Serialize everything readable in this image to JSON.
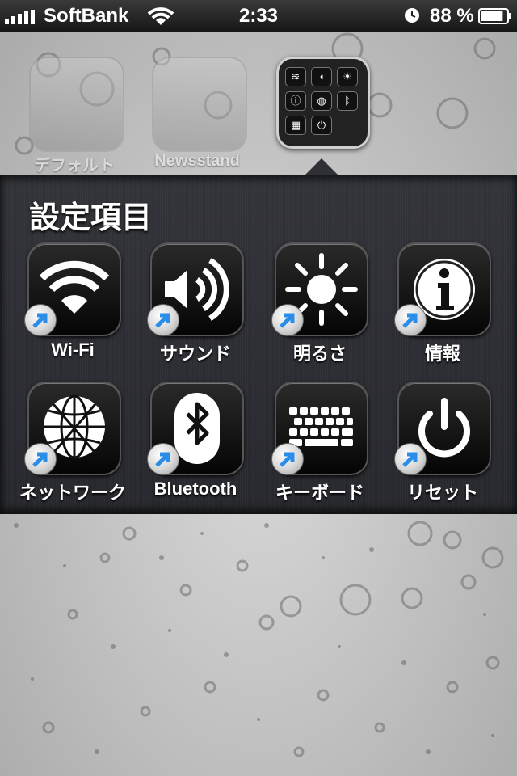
{
  "status_bar": {
    "carrier": "SoftBank",
    "time": "2:33",
    "battery_percent": "88 %",
    "battery_level": 0.88
  },
  "home_row": {
    "folder1_label": "デフォルト",
    "folder2_label": "Newsstand"
  },
  "folder": {
    "title": "設定項目",
    "apps": [
      {
        "label": "Wi-Fi",
        "icon": "wifi-icon"
      },
      {
        "label": "サウンド",
        "icon": "sound-icon"
      },
      {
        "label": "明るさ",
        "icon": "brightness-icon"
      },
      {
        "label": "情報",
        "icon": "info-icon"
      },
      {
        "label": "ネットワーク",
        "icon": "network-globe-icon"
      },
      {
        "label": "Bluetooth",
        "icon": "bluetooth-icon"
      },
      {
        "label": "キーボード",
        "icon": "keyboard-icon"
      },
      {
        "label": "リセット",
        "icon": "power-icon"
      }
    ]
  },
  "colors": {
    "panel": "#2c2d32",
    "shortcut_arrow": "#2a8ee8"
  }
}
